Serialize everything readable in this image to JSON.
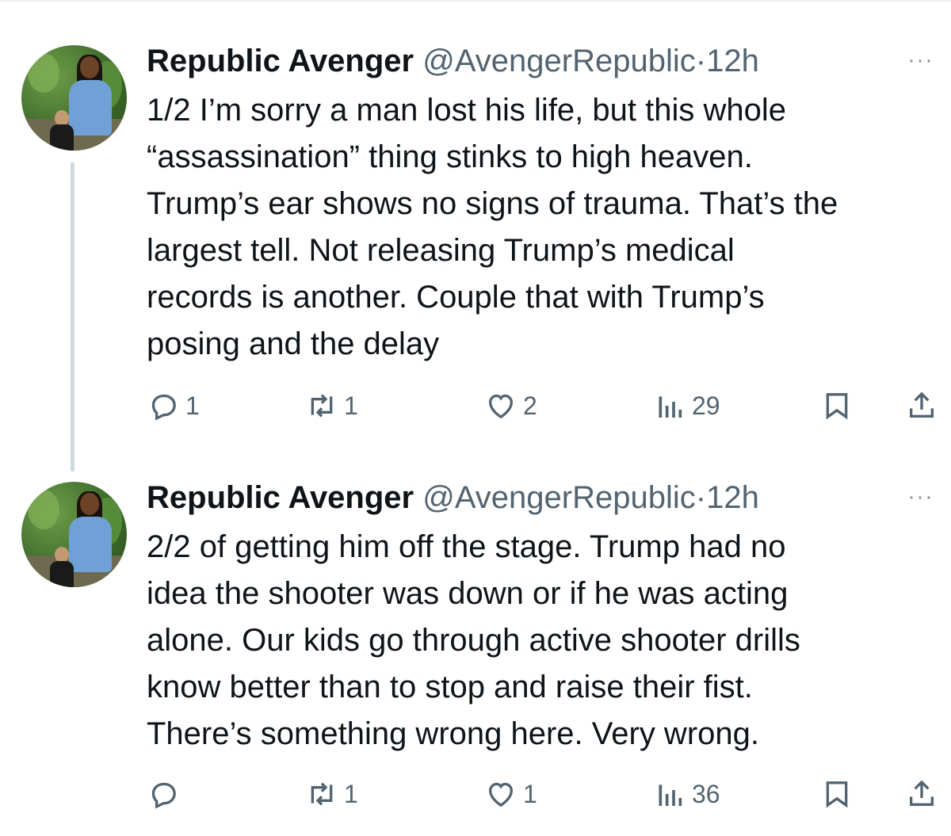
{
  "thread": {
    "tweets": [
      {
        "display_name": "Republic Avenger",
        "handle": "@AvengerRepublic",
        "separator": "·",
        "time": "12h",
        "more_label": "···",
        "text": "1/2 I’m sorry a man lost his life, but this whole\n“assassination” thing stinks to high heaven.\nTrump’s ear shows no signs of trauma. That’s the\nlargest tell. Not releasing Trump’s medical\nrecords is another. Couple that with Trump’s\nposing and the delay",
        "replies": "1",
        "reposts": "1",
        "likes": "2",
        "views": "29"
      },
      {
        "display_name": "Republic Avenger",
        "handle": "@AvengerRepublic",
        "separator": "·",
        "time": "12h",
        "more_label": "···",
        "text": "2/2 of getting him off the stage. Trump had no\nidea the shooter was down or if he was acting\nalone. Our kids go through active shooter drills\nknow better than to stop and raise their fist.\nThere’s something wrong here. Very wrong.",
        "replies": "",
        "reposts": "1",
        "likes": "1",
        "views": "36"
      }
    ]
  },
  "icons": {
    "reply": "reply-icon",
    "repost": "repost-icon",
    "like": "heart-icon",
    "views": "analytics-icon",
    "bookmark": "bookmark-icon",
    "share": "share-icon",
    "more": "more-icon"
  },
  "colors": {
    "text_primary": "#0f1419",
    "text_secondary": "#536471",
    "thread_line": "#cfd9de",
    "background": "#ffffff"
  }
}
